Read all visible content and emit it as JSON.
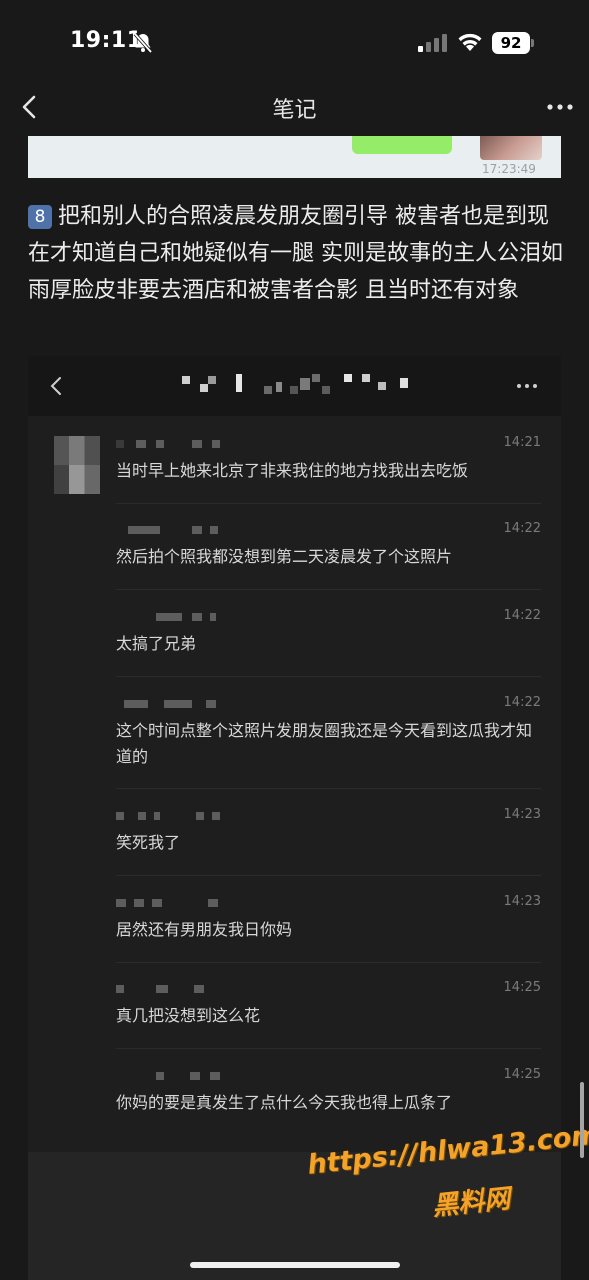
{
  "status_bar": {
    "time": "19:11",
    "battery": "92",
    "icons": [
      "bell-slash-icon",
      "signal-icon",
      "wifi-icon",
      "battery-icon"
    ]
  },
  "nav": {
    "title": "笔记",
    "back_icon": "chevron-left-icon",
    "more_icon": "more-dots-icon"
  },
  "top_image": {
    "timestamp": "17:23:49"
  },
  "note": {
    "badge": "8",
    "text": "把和别人的合照凌晨发朋友圈引导 被害者也是到现在才知道自己和她疑似有一腿 实则是故事的主人公泪如雨厚脸皮非要去酒店和被害者合影 且当时还有对象"
  },
  "chat": {
    "messages": [
      {
        "time": "14:21",
        "text": "当时早上她来北京了非来我住的地方找我出去吃饭"
      },
      {
        "time": "14:22",
        "text": "然后拍个照我都没想到第二天凌晨发了个这照片"
      },
      {
        "time": "14:22",
        "text": "太搞了兄弟"
      },
      {
        "time": "14:22",
        "text": "这个时间点整个这照片发朋友圈我还是今天看到这瓜我才知道的"
      },
      {
        "time": "14:23",
        "text": "笑死我了"
      },
      {
        "time": "14:23",
        "text": "居然还有男朋友我日你妈"
      },
      {
        "time": "14:25",
        "text": "真几把没想到这么花"
      },
      {
        "time": "14:25",
        "text": "你妈的要是真发生了点什么今天我也得上瓜条了"
      }
    ]
  },
  "watermark": {
    "url": "https://hlwa13.com",
    "name": "黑料网",
    "color": "#f3a22a"
  }
}
